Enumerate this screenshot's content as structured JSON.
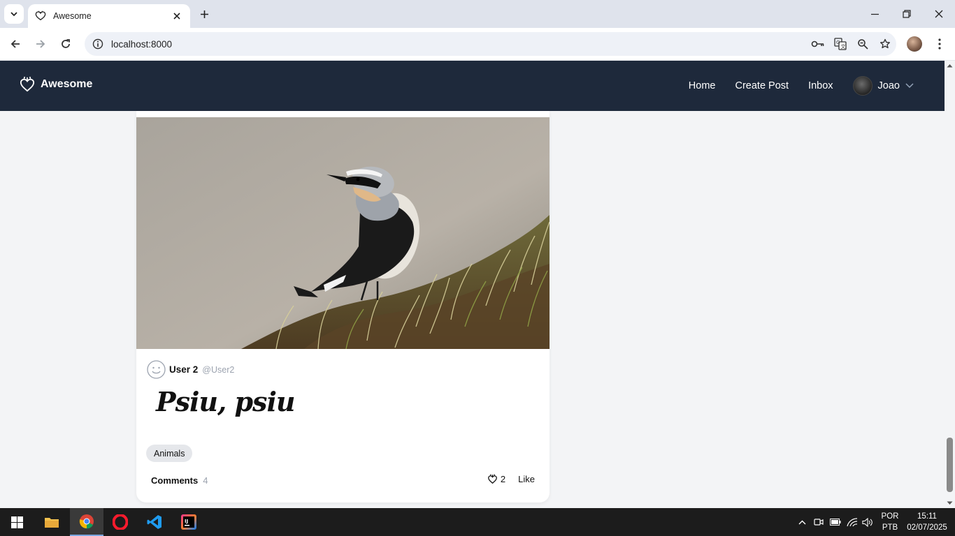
{
  "browser": {
    "tab_title": "Awesome",
    "url": "localhost:8000"
  },
  "navbar": {
    "brand": "Awesome",
    "links": [
      "Home",
      "Create Post",
      "Inbox"
    ],
    "user_name": "Joao"
  },
  "post": {
    "author_name": "User 2",
    "author_handle": "@User2",
    "title": "Psiu, psiu",
    "tag": "Animals",
    "comments_label": "Comments",
    "comments_count": "4",
    "likes_count": "2",
    "like_label": "Like"
  },
  "taskbar": {
    "language": "POR",
    "layout": "PTB",
    "time": "15:11",
    "date": "02/07/2025"
  },
  "colors": {
    "navbar_bg": "#1e293b",
    "page_bg": "#f3f4f6",
    "tag_bg": "#e5e7eb"
  }
}
